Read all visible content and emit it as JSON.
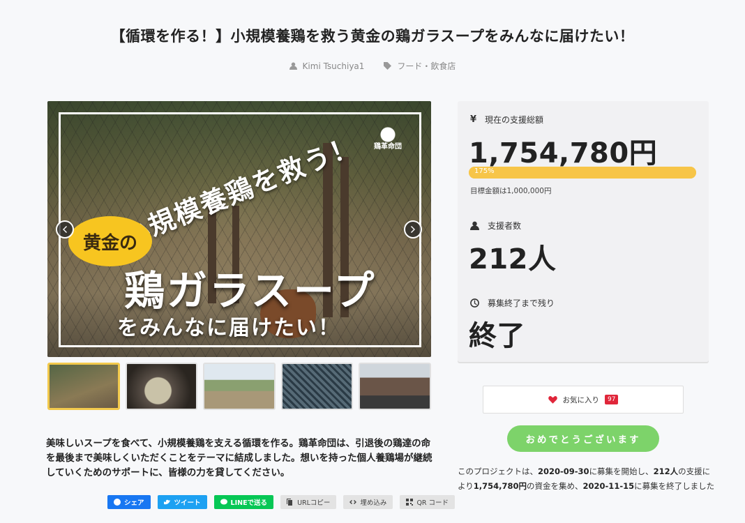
{
  "project": {
    "title": "【循環を作る！】小規模養鶏を救う黄金の鶏ガラスープをみんなに届けたい！",
    "author": "Kimi Tsuchiya1",
    "category": "フード・飲食店"
  },
  "hero": {
    "line1": "小規模養鶏を救う！",
    "bubble": "黄金の",
    "line2": "鶏ガラスープ",
    "line3": "をみんなに届けたい！",
    "logo_text": "鶏革命団"
  },
  "description": "美味しいスープを食べて、小規模養鶏を支える循環を作る。鶏革命団は、引退後の鶏達の命を最後まで美味しくいただくことをテーマに結成しました。想いを持った個人養鶏場が継続していくためのサポートに、皆様の力を貸してください。",
  "share": {
    "facebook": "シェア",
    "twitter": "ツイート",
    "line": "LINEで送る",
    "url_copy": "URLコピー",
    "embed": "埋め込み",
    "qr": "QR コード"
  },
  "stats": {
    "total_label": "現在の支援総額",
    "yen_symbol": "¥",
    "total_amount": "1,754,780円",
    "progress_percent": 175,
    "progress_label": "175%",
    "goal_text": "目標金額は1,000,000円",
    "backers_label": "支援者数",
    "backers_count": "212人",
    "remaining_label": "募集終了まで残り",
    "remaining_value": "終了"
  },
  "favorite": {
    "label": "お気に入り",
    "count": "97"
  },
  "cta": {
    "label": "おめでとうございます"
  },
  "summary": {
    "prefix": "このプロジェクトは、",
    "start_date": "2020-09-30",
    "mid1": "に募集を開始し、",
    "backers": "212人",
    "mid2": "の支援により",
    "amount": "1,754,780円",
    "mid3": "の資金を集め、",
    "end_date": "2020-11-15",
    "suffix": "に募集を終了しました"
  },
  "colors": {
    "accent_yellow": "#f7c548",
    "cta_green": "#7dd36a",
    "favorite_red": "#e0263a",
    "facebook": "#1877f2",
    "twitter": "#1da1f2",
    "line": "#06c755"
  }
}
